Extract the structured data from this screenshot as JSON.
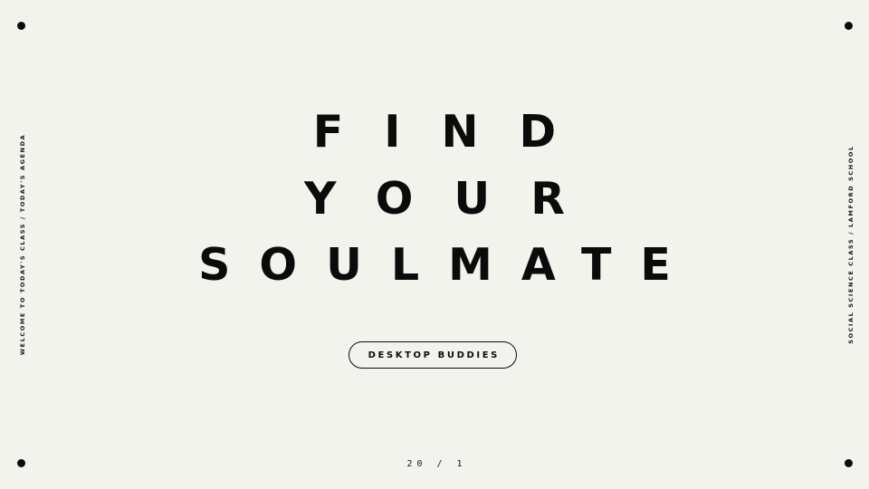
{
  "slide": {
    "headline": {
      "line1": "FIND",
      "line2": "YOUR",
      "line3": "SOULMATE"
    },
    "button_label": "DESKTOP BUDDIES",
    "left_side_text": "WELCOME TO TODAY'S CLASS / TODAY'S AGENDA",
    "right_side_text": "SOCIAL SCIENCE CLASS / LAMFORD SCHOOL",
    "page_number": "20 / 1"
  },
  "colors": {
    "background": "#f3f3ee",
    "text": "#0b0b0b"
  },
  "icons": [
    "corner-dot-icon"
  ]
}
